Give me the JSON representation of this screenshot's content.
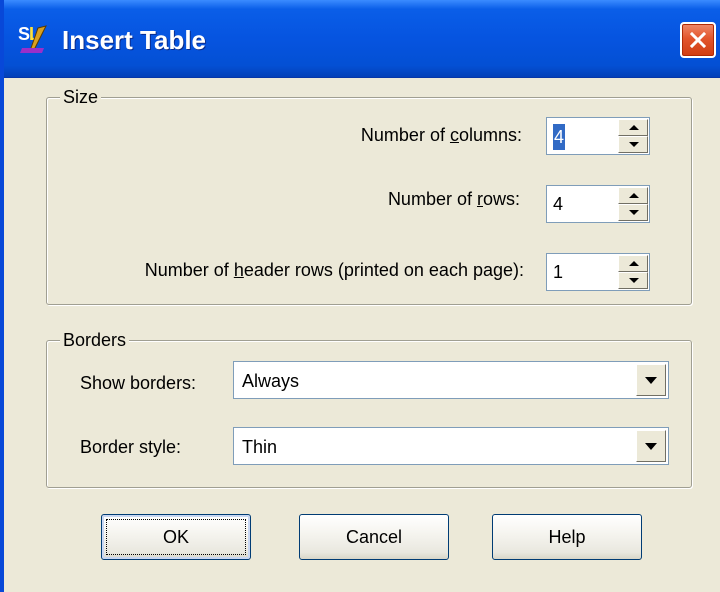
{
  "window": {
    "title": "Insert Table",
    "app_icon": "sl-app-icon",
    "close_icon": "close-icon"
  },
  "size_group": {
    "label": "Size",
    "columns": {
      "label_pre": "Number of ",
      "label_ul": "c",
      "label_post": "olumns:",
      "value": "4"
    },
    "rows": {
      "label_pre": "Number of ",
      "label_ul": "r",
      "label_post": "ows:",
      "value": "4"
    },
    "header_rows": {
      "label_pre": "Number of ",
      "label_ul": "h",
      "label_post": "eader rows (printed on each page):",
      "value": "1"
    }
  },
  "borders_group": {
    "label": "Borders",
    "show_borders": {
      "label": "Show borders:",
      "value": "Always"
    },
    "border_style": {
      "label": "Border style:",
      "value": "Thin"
    }
  },
  "buttons": {
    "ok": "OK",
    "cancel": "Cancel",
    "help": "Help"
  },
  "colors": {
    "titlebar": "#0654e0",
    "dialog_bg": "#ece9d8",
    "selection": "#316ac5",
    "close_button": "#e2552c"
  }
}
